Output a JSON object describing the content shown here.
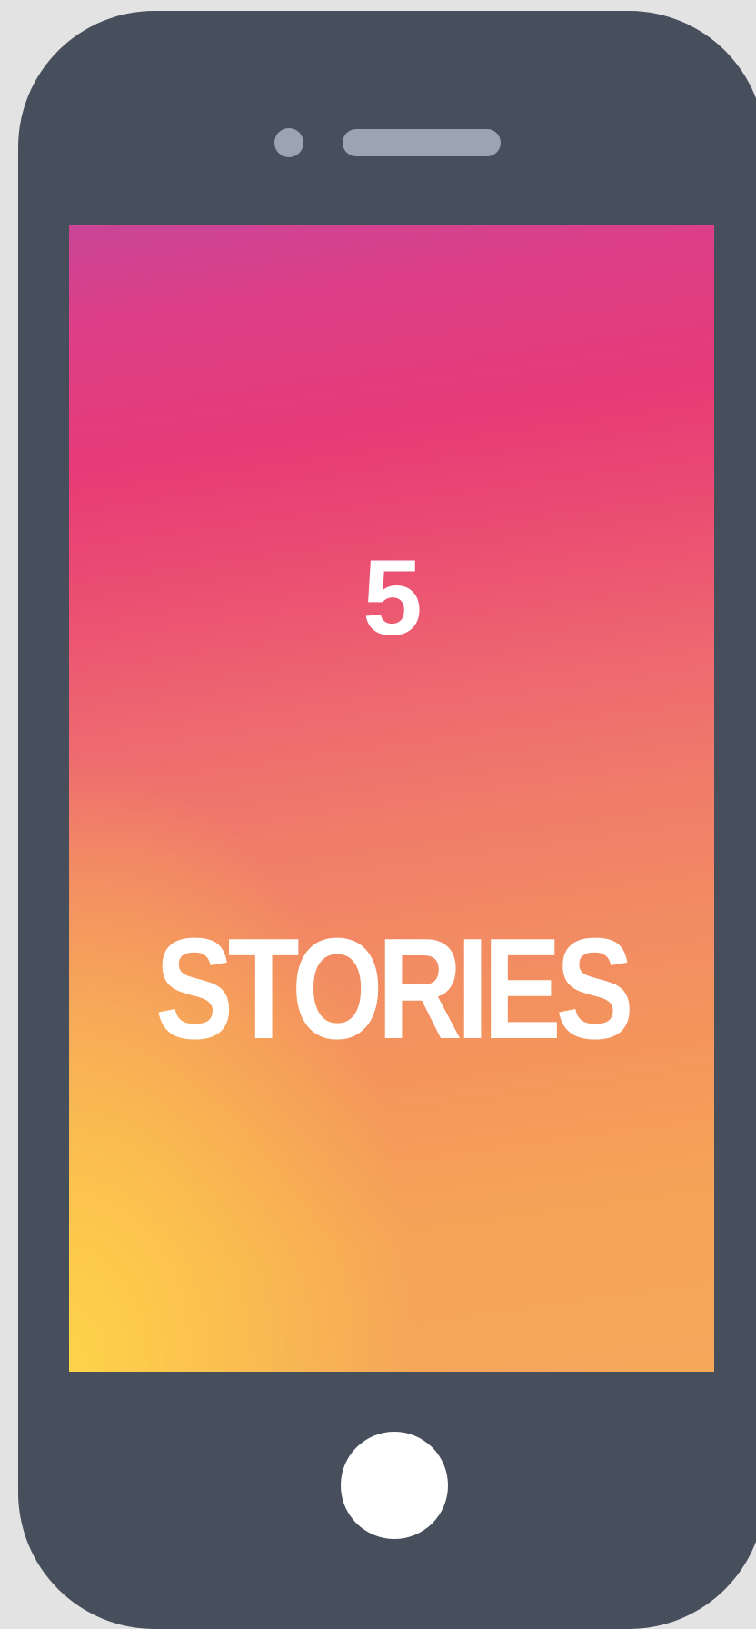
{
  "screen": {
    "number": "5",
    "label": "STORIES"
  },
  "colors": {
    "phone_body": "#474f5c",
    "camera_and_speaker": "#9ca3b1",
    "gradient_top": "#c94596",
    "gradient_mid": "#e63b77",
    "gradient_bottom": "#f5a75a",
    "gradient_corner_glow": "#ffd648",
    "text": "#ffffff",
    "home_button": "#ffffff",
    "background": "#e3e3e3"
  }
}
